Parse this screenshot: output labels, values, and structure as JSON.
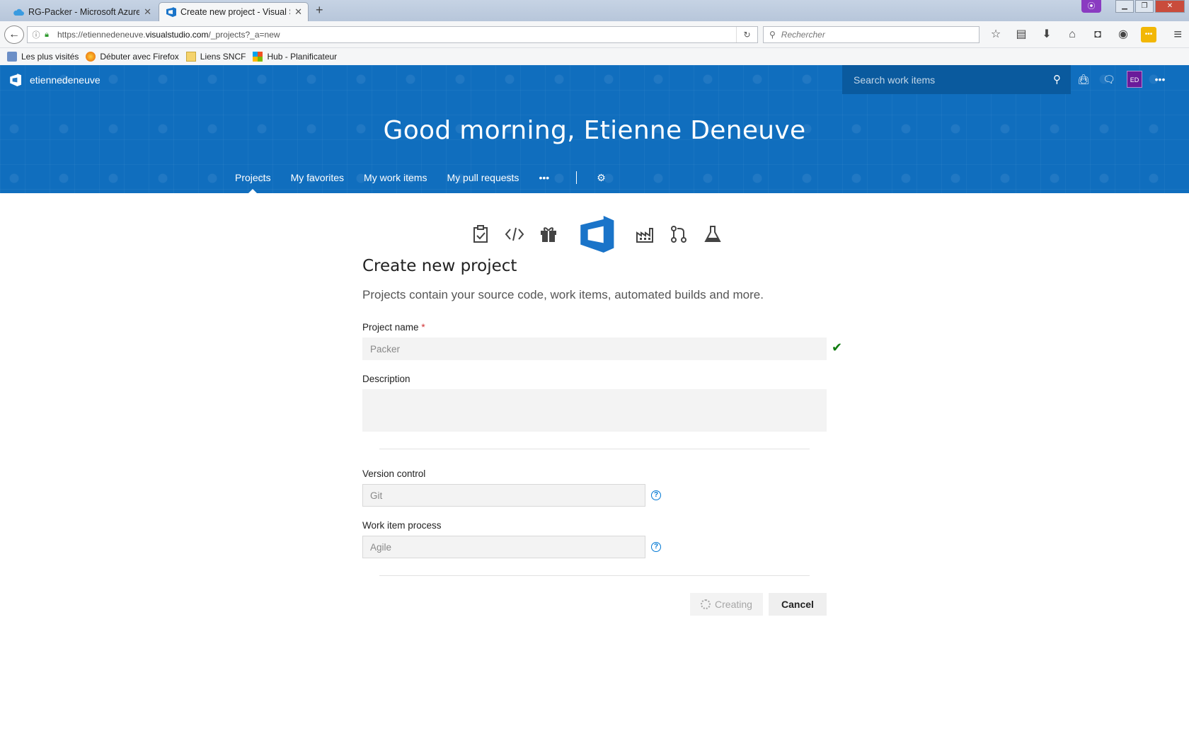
{
  "browser": {
    "tabs": [
      {
        "title": "RG-Packer - Microsoft Azure",
        "active": false
      },
      {
        "title": "Create new project - Visual St",
        "active": true
      }
    ],
    "url": {
      "prefix": "https://etiennedeneuve.",
      "domain": "visualstudio.com",
      "path": "/_projects?_a=new"
    },
    "search_placeholder": "Rechercher",
    "bookmarks": [
      "Les plus visités",
      "Débuter avec Firefox",
      "Liens SNCF",
      "Hub - Planificateur"
    ]
  },
  "header": {
    "account": "etiennedeneuve",
    "search_placeholder": "Search work items",
    "avatar_initials": "ED",
    "greeting": "Good morning, Etienne Deneuve",
    "nav": [
      "Projects",
      "My favorites",
      "My work items",
      "My pull requests"
    ],
    "more": "•••",
    "accent": "#106ebe"
  },
  "form": {
    "title": "Create new project",
    "subtitle": "Projects contain your source code, work items, automated builds and more.",
    "project_name_label": "Project name",
    "required_mark": "*",
    "project_name_value": "Packer",
    "description_label": "Description",
    "description_value": "",
    "version_control_label": "Version control",
    "version_control_value": "Git",
    "process_label": "Work item process",
    "process_value": "Agile",
    "help_glyph": "?",
    "creating_label": "Creating",
    "cancel_label": "Cancel"
  }
}
